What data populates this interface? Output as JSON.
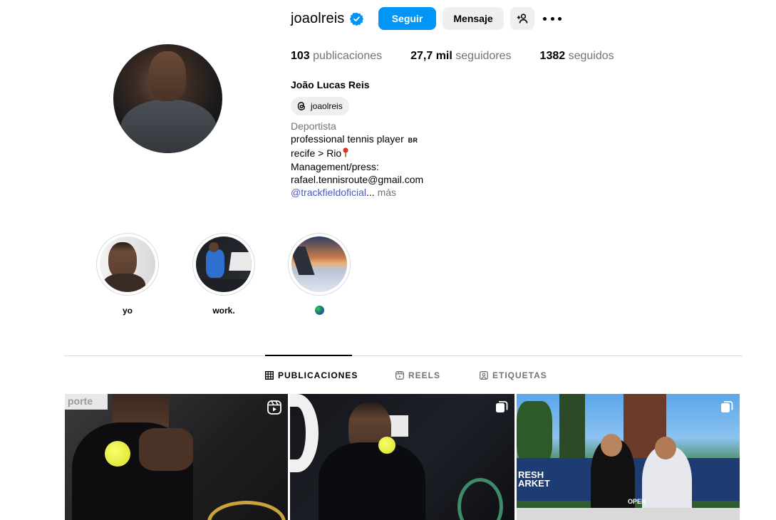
{
  "profile": {
    "username": "joaolreis",
    "verified": true,
    "follow_label": "Seguir",
    "message_label": "Mensaje",
    "stats": {
      "posts_count": "103",
      "posts_label": "publicaciones",
      "followers_count": "27,7 mil",
      "followers_label": "seguidores",
      "following_count": "1382",
      "following_label": "seguidos"
    },
    "full_name": "João Lucas Reis",
    "threads_handle": "joaolreis",
    "category": "Deportista",
    "bio_line1": "professional tennis player",
    "bio_flag": "BR",
    "bio_line2": "recife > Rio",
    "bio_line3": "Management/press:",
    "bio_line4": "rafael.tennisroute@gmail.com",
    "bio_link": "@trackfieldoficial",
    "bio_ellipsis": "...",
    "bio_more": " más"
  },
  "highlights": [
    {
      "label": "yo"
    },
    {
      "label": "work."
    },
    {
      "label": "",
      "emoji": "globe-icon"
    }
  ],
  "tabs": [
    {
      "label": "PUBLICACIONES",
      "active": true
    },
    {
      "label": "REELS",
      "active": false
    },
    {
      "label": "ETIQUETAS",
      "active": false
    }
  ],
  "posts": [
    {
      "type": "reel",
      "overlay_text": "porte"
    },
    {
      "type": "carousel"
    },
    {
      "type": "carousel",
      "overlay_text_1": "RESH",
      "overlay_text_2": "ARKET",
      "overlay_text_3": "OPEN"
    }
  ],
  "colors": {
    "accent": "#0095f6",
    "secondary_bg": "#efefef",
    "muted_text": "#737373",
    "link": "#4b59c6",
    "divider": "#dbdbdb"
  }
}
